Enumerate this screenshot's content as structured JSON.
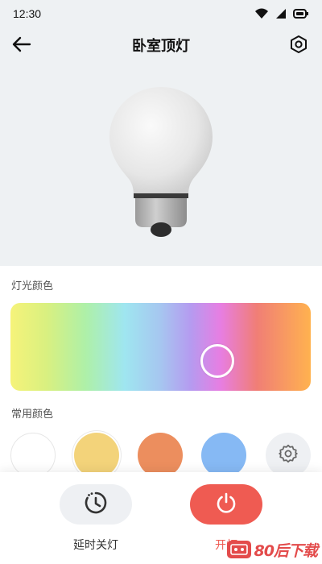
{
  "status_bar": {
    "time": "12:30",
    "icons": [
      "wifi-icon",
      "signal-icon",
      "battery-icon"
    ]
  },
  "header": {
    "title": "卧室顶灯",
    "back_icon": "arrow-left-icon",
    "settings_icon": "hexagon-settings-icon"
  },
  "hero": {
    "image": "light-bulb"
  },
  "light_color": {
    "label": "灯光颜色",
    "picker_icon": "color-picker-ring"
  },
  "common_colors": {
    "label": "常用颜色",
    "swatches": [
      {
        "name": "white",
        "color": "#ffffff"
      },
      {
        "name": "yellow",
        "color": "#f3d37a",
        "selected": true
      },
      {
        "name": "orange",
        "color": "#ec8e5e"
      },
      {
        "name": "blue",
        "color": "#86b9f4"
      }
    ],
    "settings_icon": "gear-icon"
  },
  "actions": {
    "timer": {
      "label": "延时关灯",
      "icon": "timer-icon"
    },
    "power": {
      "label": "开灯",
      "icon": "power-icon",
      "color": "#ef5b52"
    }
  },
  "watermark": {
    "text": "80后下载"
  }
}
